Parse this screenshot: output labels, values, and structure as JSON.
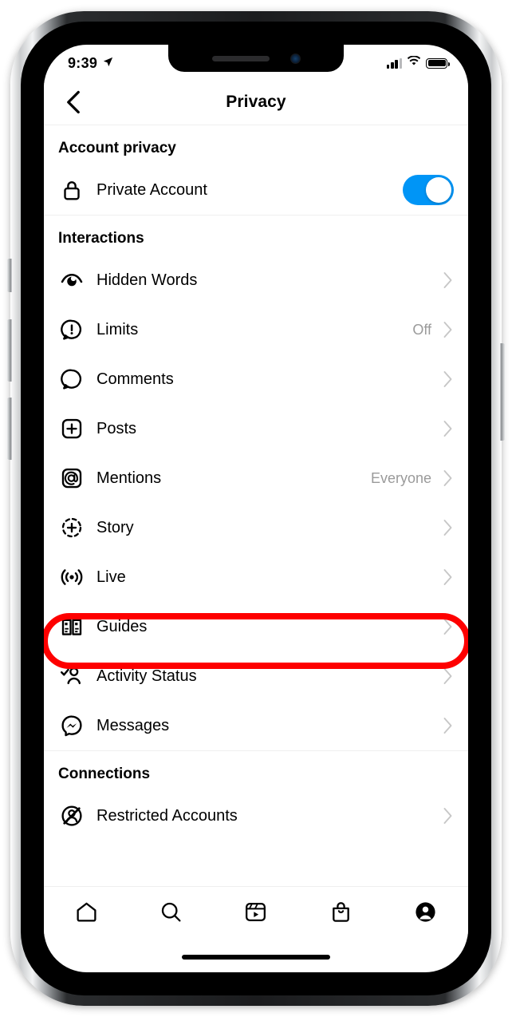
{
  "status_bar": {
    "time": "9:39",
    "location_icon": "location-arrow-icon",
    "signal_icon": "cellular-signal-icon",
    "wifi_icon": "wifi-icon",
    "battery_icon": "battery-full-icon"
  },
  "header": {
    "title": "Privacy",
    "back_icon": "chevron-left-icon"
  },
  "sections": [
    {
      "id": "account-privacy",
      "title": "Account privacy",
      "rows": [
        {
          "id": "private-account",
          "label": "Private Account",
          "icon": "lock-icon",
          "control": "toggle",
          "toggle_on": true,
          "value": ""
        }
      ]
    },
    {
      "id": "interactions",
      "title": "Interactions",
      "rows": [
        {
          "id": "hidden-words",
          "label": "Hidden Words",
          "icon": "eye-icon",
          "control": "chevron",
          "value": ""
        },
        {
          "id": "limits",
          "label": "Limits",
          "icon": "alert-bubble-icon",
          "control": "chevron",
          "value": "Off"
        },
        {
          "id": "comments",
          "label": "Comments",
          "icon": "comment-bubble-icon",
          "control": "chevron",
          "value": ""
        },
        {
          "id": "posts",
          "label": "Posts",
          "icon": "plus-square-icon",
          "control": "chevron",
          "value": ""
        },
        {
          "id": "mentions",
          "label": "Mentions",
          "icon": "at-sign-icon",
          "control": "chevron",
          "value": "Everyone"
        },
        {
          "id": "story",
          "label": "Story",
          "icon": "story-plus-icon",
          "control": "chevron",
          "value": ""
        },
        {
          "id": "live",
          "label": "Live",
          "icon": "live-broadcast-icon",
          "control": "chevron",
          "value": ""
        },
        {
          "id": "guides",
          "label": "Guides",
          "icon": "guides-book-icon",
          "control": "chevron",
          "value": ""
        },
        {
          "id": "activity-status",
          "label": "Activity Status",
          "icon": "person-check-icon",
          "control": "chevron",
          "value": "",
          "highlighted": true
        },
        {
          "id": "messages",
          "label": "Messages",
          "icon": "messenger-icon",
          "control": "chevron",
          "value": ""
        }
      ]
    },
    {
      "id": "connections",
      "title": "Connections",
      "rows": [
        {
          "id": "restricted-accounts",
          "label": "Restricted Accounts",
          "icon": "restricted-person-icon",
          "control": "chevron",
          "value": ""
        }
      ]
    }
  ],
  "tab_bar": {
    "items": [
      {
        "id": "home",
        "icon": "home-icon",
        "label": "Home"
      },
      {
        "id": "search",
        "icon": "search-icon",
        "label": "Search"
      },
      {
        "id": "reels",
        "icon": "reels-icon",
        "label": "Reels"
      },
      {
        "id": "shop",
        "icon": "shop-bag-icon",
        "label": "Shop"
      },
      {
        "id": "profile",
        "icon": "profile-avatar-icon",
        "label": "Profile"
      }
    ]
  },
  "annotation": {
    "type": "red-outline-highlight",
    "target_row_id": "activity-status",
    "color": "#fe0000"
  },
  "colors": {
    "accent_blue": "#0095f6",
    "highlight_red": "#fe0000",
    "divider": "#efefef",
    "secondary_text": "#9a9a9a",
    "primary_text": "#000000",
    "background": "#ffffff"
  }
}
